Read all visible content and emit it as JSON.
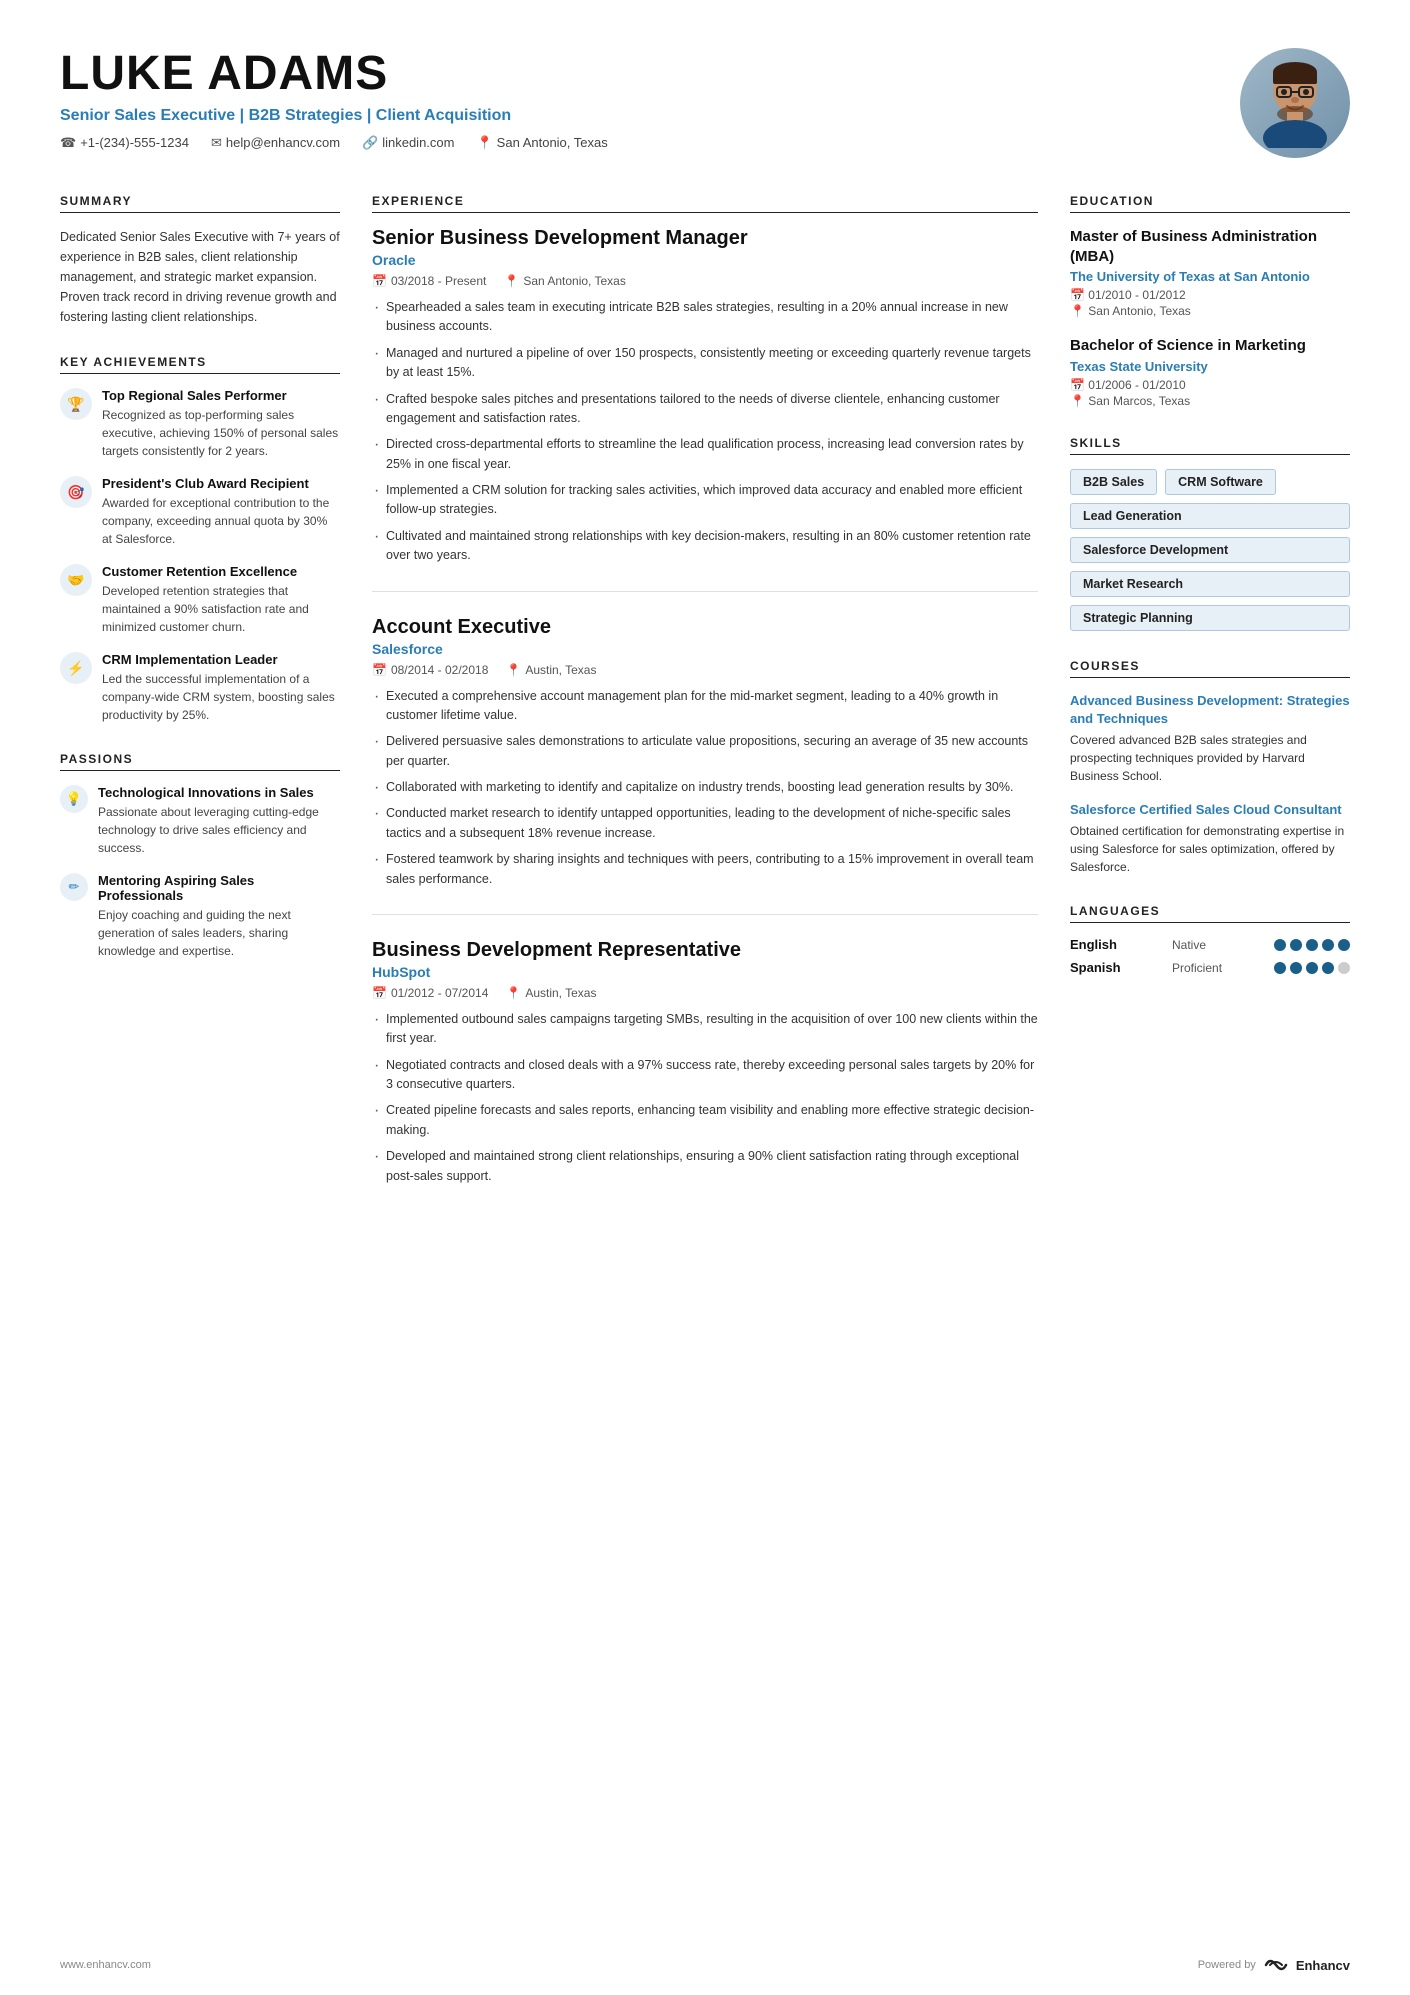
{
  "header": {
    "name": "LUKE ADAMS",
    "title": "Senior Sales Executive | B2B Strategies | Client Acquisition",
    "contacts": [
      {
        "icon": "📞",
        "text": "+1-(234)-555-1234"
      },
      {
        "icon": "✉",
        "text": "help@enhancv.com"
      },
      {
        "icon": "🔗",
        "text": "linkedin.com"
      },
      {
        "icon": "📍",
        "text": "San Antonio, Texas"
      }
    ]
  },
  "summary": {
    "section_title": "SUMMARY",
    "text": "Dedicated Senior Sales Executive with 7+ years of experience in B2B sales, client relationship management, and strategic market expansion. Proven track record in driving revenue growth and fostering lasting client relationships."
  },
  "key_achievements": {
    "section_title": "KEY ACHIEVEMENTS",
    "items": [
      {
        "icon": "🏆",
        "title": "Top Regional Sales Performer",
        "desc": "Recognized as top-performing sales executive, achieving 150% of personal sales targets consistently for 2 years."
      },
      {
        "icon": "🎯",
        "title": "President's Club Award Recipient",
        "desc": "Awarded for exceptional contribution to the company, exceeding annual quota by 30% at Salesforce."
      },
      {
        "icon": "🤝",
        "title": "Customer Retention Excellence",
        "desc": "Developed retention strategies that maintained a 90% satisfaction rate and minimized customer churn."
      },
      {
        "icon": "⚡",
        "title": "CRM Implementation Leader",
        "desc": "Led the successful implementation of a company-wide CRM system, boosting sales productivity by 25%."
      }
    ]
  },
  "passions": {
    "section_title": "PASSIONS",
    "items": [
      {
        "icon": "💡",
        "title": "Technological Innovations in Sales",
        "desc": "Passionate about leveraging cutting-edge technology to drive sales efficiency and success."
      },
      {
        "icon": "✏",
        "title": "Mentoring Aspiring Sales Professionals",
        "desc": "Enjoy coaching and guiding the next generation of sales leaders, sharing knowledge and expertise."
      }
    ]
  },
  "experience": {
    "section_title": "EXPERIENCE",
    "jobs": [
      {
        "title": "Senior Business Development Manager",
        "company": "Oracle",
        "date": "03/2018 - Present",
        "location": "San Antonio, Texas",
        "bullets": [
          "Spearheaded a sales team in executing intricate B2B sales strategies, resulting in a 20% annual increase in new business accounts.",
          "Managed and nurtured a pipeline of over 150 prospects, consistently meeting or exceeding quarterly revenue targets by at least 15%.",
          "Crafted bespoke sales pitches and presentations tailored to the needs of diverse clientele, enhancing customer engagement and satisfaction rates.",
          "Directed cross-departmental efforts to streamline the lead qualification process, increasing lead conversion rates by 25% in one fiscal year.",
          "Implemented a CRM solution for tracking sales activities, which improved data accuracy and enabled more efficient follow-up strategies.",
          "Cultivated and maintained strong relationships with key decision-makers, resulting in an 80% customer retention rate over two years."
        ]
      },
      {
        "title": "Account Executive",
        "company": "Salesforce",
        "date": "08/2014 - 02/2018",
        "location": "Austin, Texas",
        "bullets": [
          "Executed a comprehensive account management plan for the mid-market segment, leading to a 40% growth in customer lifetime value.",
          "Delivered persuasive sales demonstrations to articulate value propositions, securing an average of 35 new accounts per quarter.",
          "Collaborated with marketing to identify and capitalize on industry trends, boosting lead generation results by 30%.",
          "Conducted market research to identify untapped opportunities, leading to the development of niche-specific sales tactics and a subsequent 18% revenue increase.",
          "Fostered teamwork by sharing insights and techniques with peers, contributing to a 15% improvement in overall team sales performance."
        ]
      },
      {
        "title": "Business Development Representative",
        "company": "HubSpot",
        "date": "01/2012 - 07/2014",
        "location": "Austin, Texas",
        "bullets": [
          "Implemented outbound sales campaigns targeting SMBs, resulting in the acquisition of over 100 new clients within the first year.",
          "Negotiated contracts and closed deals with a 97% success rate, thereby exceeding personal sales targets by 20% for 3 consecutive quarters.",
          "Created pipeline forecasts and sales reports, enhancing team visibility and enabling more effective strategic decision-making.",
          "Developed and maintained strong client relationships, ensuring a 90% client satisfaction rating through exceptional post-sales support."
        ]
      }
    ]
  },
  "education": {
    "section_title": "EDUCATION",
    "items": [
      {
        "degree": "Master of Business Administration (MBA)",
        "school": "The University of Texas at San Antonio",
        "date": "01/2010 - 01/2012",
        "location": "San Antonio, Texas"
      },
      {
        "degree": "Bachelor of Science in Marketing",
        "school": "Texas State University",
        "date": "01/2006 - 01/2010",
        "location": "San Marcos, Texas"
      }
    ]
  },
  "skills": {
    "section_title": "SKILLS",
    "items": [
      {
        "label": "B2B Sales",
        "full": false
      },
      {
        "label": "CRM Software",
        "full": false
      },
      {
        "label": "Lead Generation",
        "full": true
      },
      {
        "label": "Salesforce Development",
        "full": true
      },
      {
        "label": "Market Research",
        "full": true
      },
      {
        "label": "Strategic Planning",
        "full": true
      }
    ]
  },
  "courses": {
    "section_title": "COURSES",
    "items": [
      {
        "title": "Advanced Business Development: Strategies and Techniques",
        "desc": "Covered advanced B2B sales strategies and prospecting techniques provided by Harvard Business School."
      },
      {
        "title": "Salesforce Certified Sales Cloud Consultant",
        "desc": "Obtained certification for demonstrating expertise in using Salesforce for sales optimization, offered by Salesforce."
      }
    ]
  },
  "languages": {
    "section_title": "LANGUAGES",
    "items": [
      {
        "name": "English",
        "level": "Native",
        "filled": 5,
        "total": 5
      },
      {
        "name": "Spanish",
        "level": "Proficient",
        "filled": 4,
        "total": 5
      }
    ]
  },
  "footer": {
    "website": "www.enhancv.com",
    "powered_by": "Powered by",
    "brand": "Enhancv"
  }
}
